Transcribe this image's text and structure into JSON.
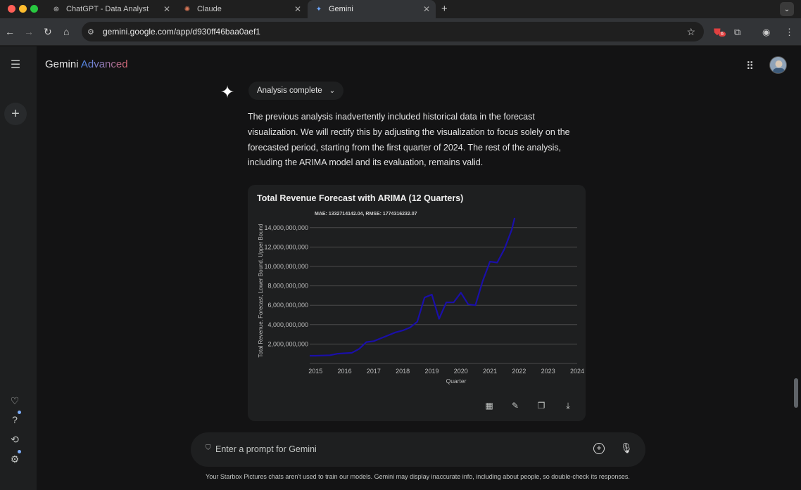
{
  "browser": {
    "tabs": [
      {
        "title": "ChatGPT - Data Analyst",
        "icon": "chatgpt-icon"
      },
      {
        "title": "Claude",
        "icon": "claude-icon"
      },
      {
        "title": "Gemini",
        "icon": "gemini-icon",
        "active": true
      }
    ],
    "url": "gemini.google.com/app/d930ff46baa0aef1",
    "extension_badge": "6"
  },
  "app": {
    "brand": "Gemini",
    "brand_tier": "Advanced"
  },
  "response": {
    "status_chip": "Analysis complete",
    "text": "The previous analysis inadvertently included historical data in the forecast visualization. We will rectify this by adjusting the visualization to focus solely on the forecasted period, starting from the first quarter of 2024. The rest of the analysis, including the ARIMA model and its evaluation, remains valid."
  },
  "chart_card": {
    "title": "Total Revenue Forecast with ARIMA (12 Quarters)",
    "actions": [
      "table-icon",
      "edit-icon",
      "copy-icon",
      "download-icon"
    ]
  },
  "chart_data": {
    "type": "line",
    "title": "Total Revenue Forecast with ARIMA (12 Quarters)",
    "subtitle": "MAE: 1332714142.04, RMSE: 1774316232.07",
    "xlabel": "Quarter",
    "ylabel": "Total Revenue, Forecast, Lower Bound, Upper Bound",
    "x_ticks": [
      "2015",
      "2016",
      "2017",
      "2018",
      "2019",
      "2020",
      "2021",
      "2022",
      "2023",
      "2024"
    ],
    "y_ticks": [
      "2,000,000,000",
      "4,000,000,000",
      "6,000,000,000",
      "8,000,000,000",
      "10,000,000,000",
      "12,000,000,000",
      "14,000,000,000"
    ],
    "ylim": [
      0,
      15000000000
    ],
    "xlim": [
      2014.8,
      2024.0
    ],
    "grid": true,
    "series": [
      {
        "color": "#1a0fa8",
        "x": [
          2014.8,
          2015.0,
          2015.25,
          2015.5,
          2015.75,
          2016.0,
          2016.25,
          2016.5,
          2016.75,
          2017.0,
          2017.25,
          2017.5,
          2017.75,
          2018.0,
          2018.25,
          2018.5,
          2018.75,
          2019.0,
          2019.25,
          2019.5,
          2019.75,
          2020.0,
          2020.25,
          2020.5,
          2020.75,
          2021.0,
          2021.25,
          2021.5,
          2021.75,
          2021.85
        ],
        "y": [
          800000000,
          800000000,
          820000000,
          850000000,
          1000000000,
          1050000000,
          1100000000,
          1500000000,
          2200000000,
          2300000000,
          2600000000,
          2900000000,
          3200000000,
          3400000000,
          3700000000,
          4300000000,
          6800000000,
          7100000000,
          4600000000,
          6300000000,
          6300000000,
          7300000000,
          6100000000,
          6000000000,
          8500000000,
          10500000000,
          10400000000,
          11800000000,
          13800000000,
          15000000000
        ]
      }
    ]
  },
  "prompt": {
    "placeholder": "Enter a prompt for Gemini"
  },
  "disclaimer": "Your Starbox Pictures chats aren't used to train our models. Gemini may display inaccurate info, including about people, so double-check its responses."
}
